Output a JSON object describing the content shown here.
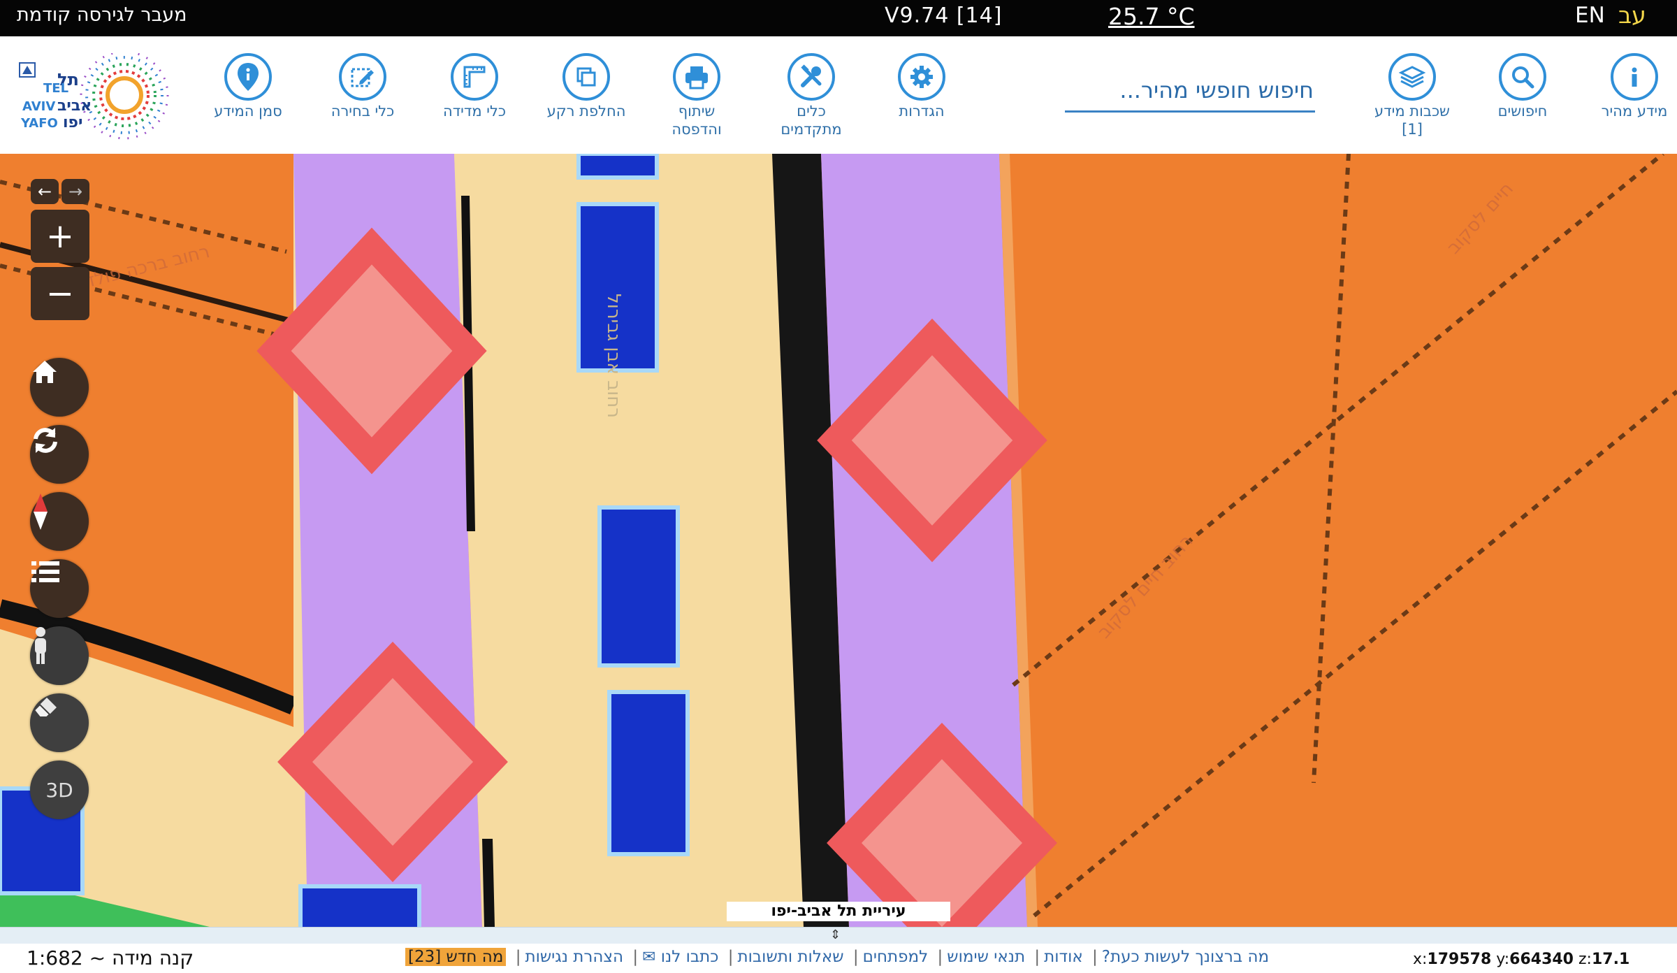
{
  "topbar": {
    "prev_version_link": "מעבר לגירסה קודמת",
    "version": "V9.74 [14]",
    "temperature": "25.7 °C",
    "lang_en": "EN",
    "lang_he": "עב"
  },
  "toolbar": {
    "quick_info": "מידע מהיר",
    "searches": "חיפושים",
    "info_layers": "שכבות מידע",
    "info_layers_count": "[1]",
    "search_placeholder": "חיפוש חופשי מהיר...",
    "settings": "הגדרות",
    "advanced_tools_1": "כלים",
    "advanced_tools_2": "מתקדמים",
    "share_print_1": "שיתוף",
    "share_print_2": "והדפסה",
    "basemap_switch": "החלפת רקע",
    "measure_tools": "כלי מדידה",
    "select_tools": "כלי בחירה",
    "info_marker": "סמן המידע"
  },
  "logo": {
    "text_tel": "TEL",
    "text_aviv": "AVIV",
    "text_yafo": "YAFO",
    "text_he_1": "תל",
    "text_he_2": "אביב",
    "text_he_3": "יפו"
  },
  "map": {
    "attribution": "עיריית תל אביב-יפו",
    "street_labels": [
      "רחוב ברכה פולד",
      "רחוב אבן גבירול",
      "רחוב חיים לסקוב",
      "חיים לסקוב"
    ]
  },
  "controls": {
    "zoom_in": "+",
    "zoom_out": "−",
    "three_d": "3D"
  },
  "footer": {
    "scale_label": "קנה מידה ~",
    "scale_value": "1:682",
    "links": [
      "מה ברצונך לעשות כעת?",
      "אודות",
      "תנאי שימוש",
      "למפתחים",
      "שאלות ותשובות",
      "כתבו לנו ✉",
      "הצהרת נגישות"
    ],
    "news_label": "מה חדש [23]",
    "coord_x_label": "x:",
    "coord_x": "179578",
    "coord_y_label": "y:",
    "coord_y": "664340",
    "coord_z_label": "z:",
    "coord_z": "17.1"
  },
  "colors": {
    "accent": "#2f8fd8",
    "map_orange": "#ef7f2f",
    "road_purple": "#c69af2",
    "sidewalk_beige": "#f6dba0",
    "marker_red": "#ee5a5c",
    "building_blue": "#1532c8",
    "control_brown": "#3e2d22",
    "news_badge": "#f0a43a"
  }
}
